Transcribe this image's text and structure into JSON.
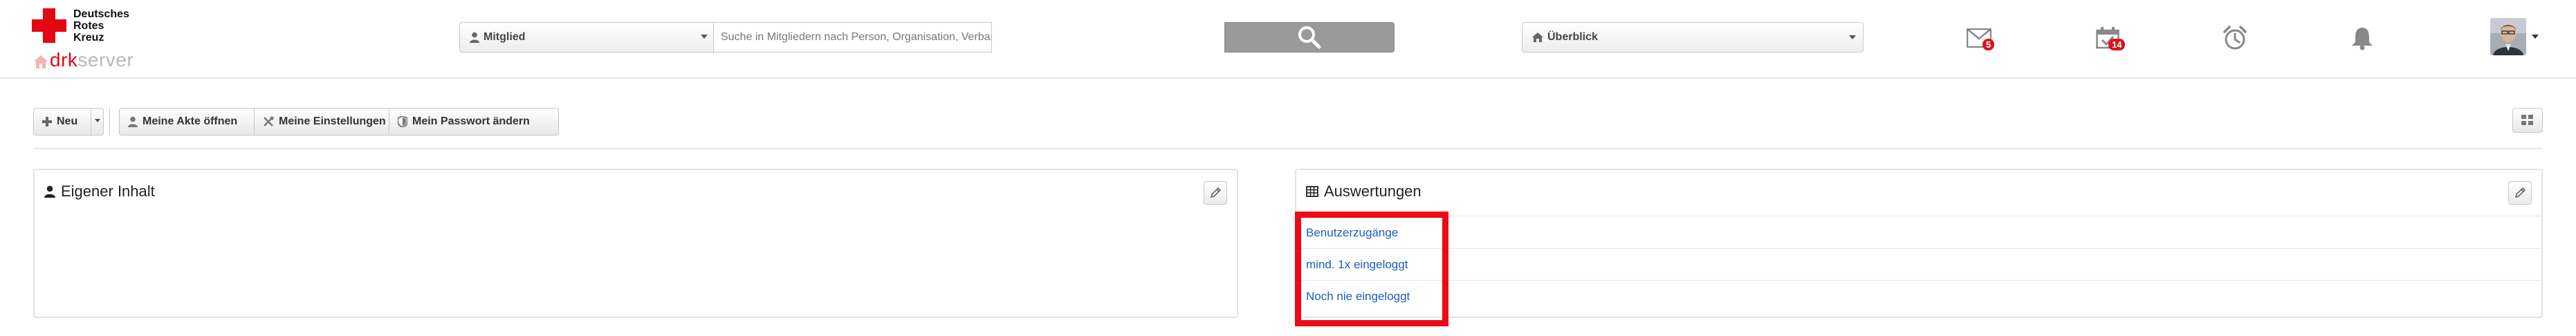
{
  "header": {
    "logo": {
      "org_line1": "Deutsches",
      "org_line2": "Rotes",
      "org_line3": "Kreuz",
      "brand_prefix": "drk",
      "brand_suffix": "server"
    },
    "search": {
      "scope_label": "Mitglied",
      "placeholder": "Suche in Mitgliedern nach Person, Organisation, Verband etc…",
      "value": ""
    },
    "view_select": {
      "label": "Überblick"
    },
    "icons": {
      "mail": {
        "icon": "envelope-icon",
        "badge": "5"
      },
      "tasks": {
        "icon": "calendar-check-icon",
        "badge": "14"
      },
      "reminders": {
        "icon": "alarm-clock-icon"
      },
      "notifications": {
        "icon": "bell-icon"
      }
    }
  },
  "toolbar": {
    "new_label": "Neu",
    "open_file_label": "Meine Akte öffnen",
    "settings_label": "Meine Einstellungen",
    "password_label": "Mein Passwort ändern"
  },
  "panels": {
    "own_content": {
      "title": "Eigener Inhalt"
    },
    "reports": {
      "title": "Auswertungen",
      "items": [
        {
          "label": "Benutzerzugänge"
        },
        {
          "label": "mind. 1x eingeloggt"
        },
        {
          "label": "Noch nie eingeloggt"
        }
      ]
    }
  },
  "colors": {
    "drk_red": "#e30613",
    "link_blue": "#1b5fb4",
    "highlight_red": "#ee0a18",
    "badge_red": "#d9131f"
  }
}
